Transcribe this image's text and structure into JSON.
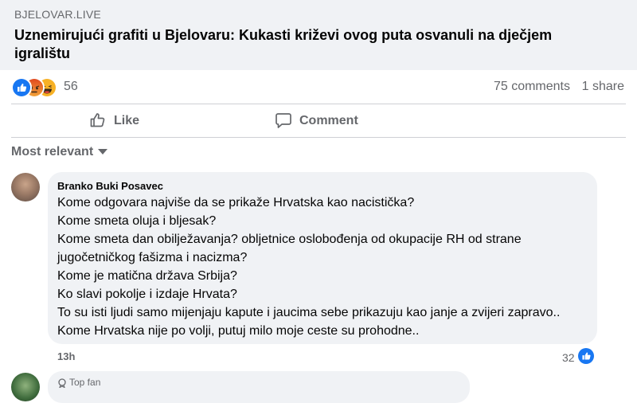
{
  "post": {
    "domain": "BJELOVAR.LIVE",
    "headline": "Uznemirujući grafiti u Bjelovaru: Kukasti križevi ovog puta osvanuli na dječjem igralištu"
  },
  "stats": {
    "reaction_icons": [
      "like-icon",
      "angry-icon",
      "haha-icon"
    ],
    "reactions_count": "56",
    "comments_label": "75 comments",
    "shares_label": "1 share"
  },
  "actions": {
    "like_label": "Like",
    "comment_label": "Comment"
  },
  "sort": {
    "label": "Most relevant"
  },
  "comment": {
    "author": "Branko Buki Posavec",
    "lines": [
      "Kome odgovara najviše da se prikaže Hrvatska kao nacistička?",
      "Kome smeta oluja i bljesak?",
      "Kome smeta dan obilježavanja? obljetnice oslobođenja od okupacije RH od strane",
      "jugočetničkog fašizma i nacizma?",
      "Kome je matična država Srbija?",
      "Ko slavi pokolje i izdaje Hrvata?",
      "To su isti ljudi samo mijenjaju kapute i jaucima sebe prikazuju kao janje a zvijeri zapravo..",
      "Kome Hrvatska nije po volji, putuj milo moje ceste su prohodne.."
    ],
    "time": "13h",
    "likes": "32"
  },
  "next_comment": {
    "badge": "Top fan"
  },
  "colors": {
    "like_blue": "#1877f2",
    "angry": "#e9710f",
    "haha": "#f7b125",
    "muted": "#65676b"
  }
}
